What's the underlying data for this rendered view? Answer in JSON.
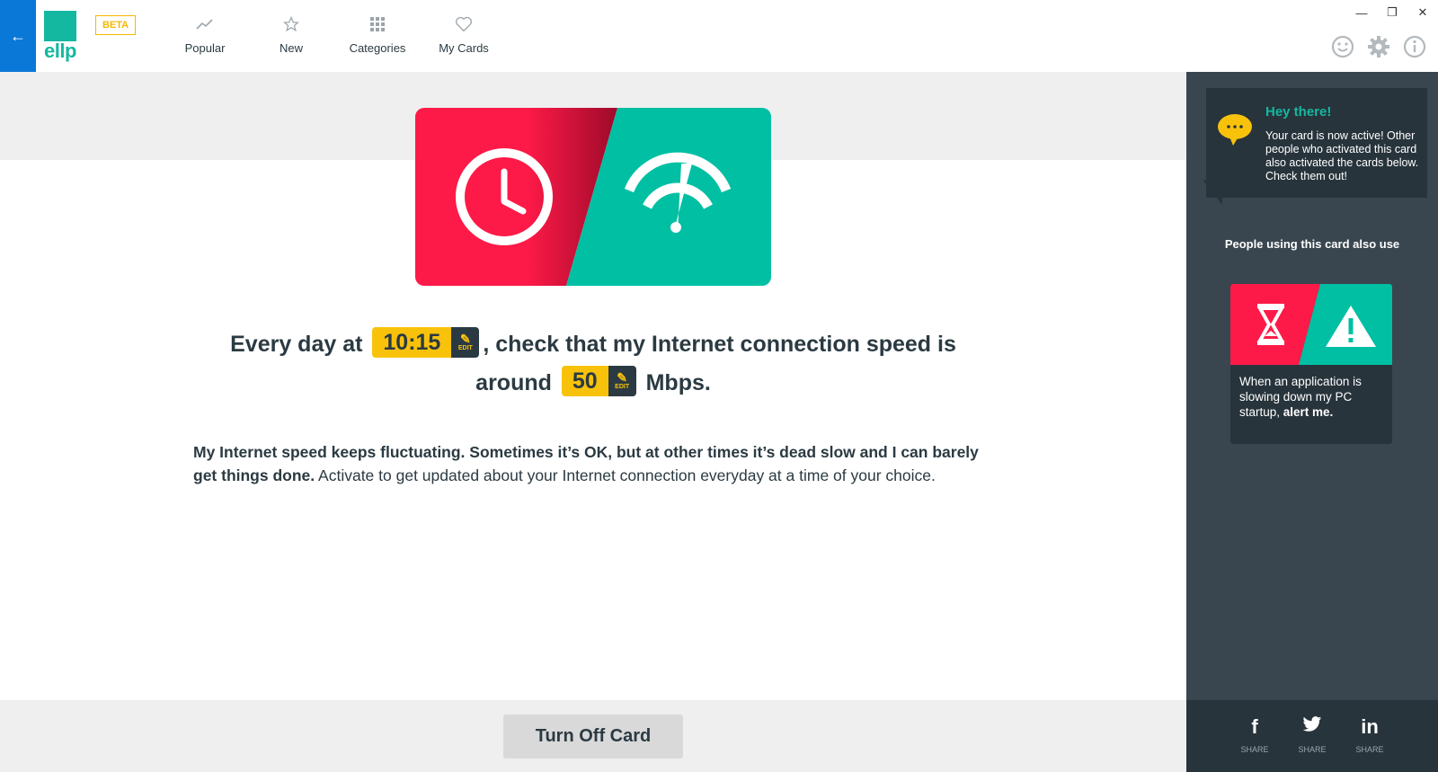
{
  "topbar": {
    "back_label": "←",
    "logo_text": "ellp",
    "beta_label": "BETA",
    "nav": [
      {
        "label": "Popular",
        "icon": "trending-icon"
      },
      {
        "label": "New",
        "icon": "star-icon"
      },
      {
        "label": "Categories",
        "icon": "grid-icon"
      },
      {
        "label": "My Cards",
        "icon": "heart-icon"
      }
    ],
    "window_controls": {
      "minimize": "—",
      "restore": "❐",
      "close": "✕"
    },
    "actions": [
      "smiley-icon",
      "gear-icon",
      "info-icon"
    ]
  },
  "card": {
    "sentence_part1": "Every day at",
    "time_value": "10:15",
    "sentence_part2": ", check that my Internet connection speed is",
    "sentence_part3": "around",
    "speed_value": "50",
    "sentence_part4": "Mbps.",
    "edit_label": "EDIT",
    "colors": {
      "red": "#fe1a48",
      "teal": "#00bfa3"
    }
  },
  "description": {
    "bold": "My Internet speed keeps fluctuating. Sometimes it’s OK, but at other times it’s dead slow and I can barely get things done.",
    "normal": " Activate to get updated about your Internet connection everyday at a time of your choice."
  },
  "footer": {
    "turn_off_label": "Turn Off Card"
  },
  "sidebar": {
    "bubble_title": "Hey there!",
    "bubble_text": "Your card is now active! Other people who activated this card also activated the cards below. Check them out!",
    "people_title": "People using this card also use",
    "related_card": {
      "text_normal": "When an application is slowing down my PC startup, ",
      "text_bold": "alert me."
    },
    "share": [
      {
        "icon": "facebook-icon",
        "glyph": "f",
        "label": "SHARE"
      },
      {
        "icon": "twitter-icon",
        "glyph": "🐦",
        "label": "SHARE"
      },
      {
        "icon": "linkedin-icon",
        "glyph": "in",
        "label": "SHARE"
      }
    ]
  }
}
